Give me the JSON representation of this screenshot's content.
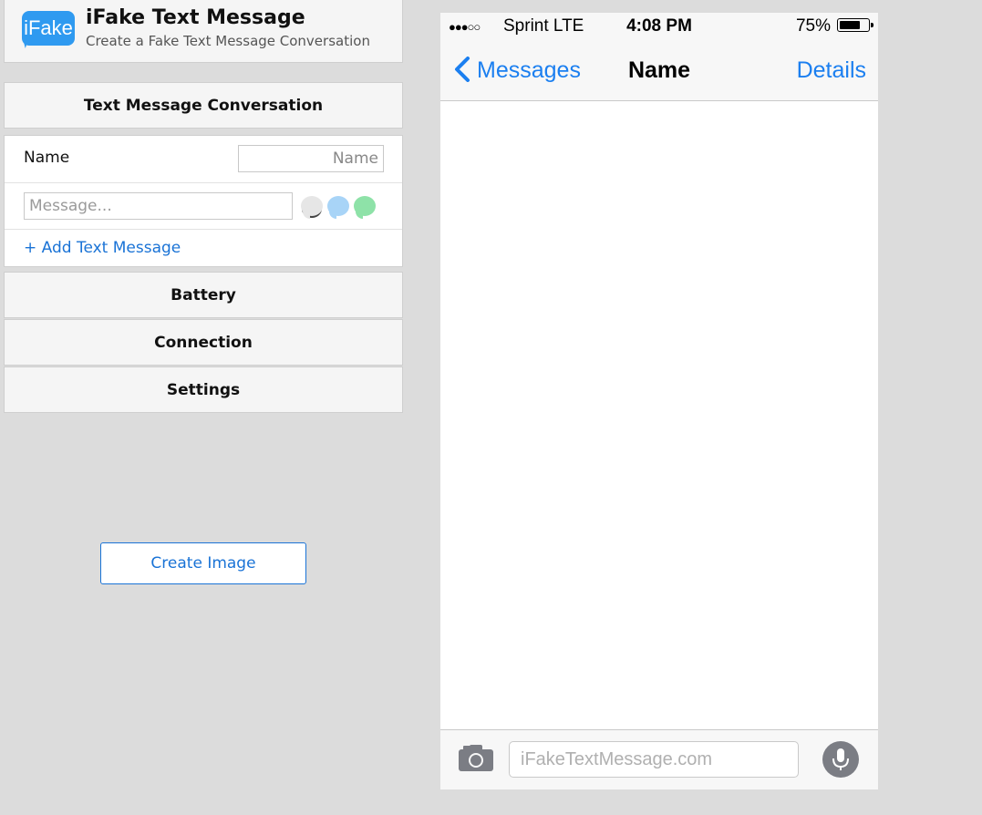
{
  "app": {
    "logo_text": "iFake",
    "title": "iFake Text Message",
    "subtitle": "Create a Fake Text Message Conversation"
  },
  "conversation": {
    "heading": "Text Message Conversation",
    "name_label": "Name",
    "name_placeholder": "Name",
    "message_placeholder": "Message...",
    "add_label": "+ Add Text Message"
  },
  "sections": {
    "battery": "Battery",
    "connection": "Connection",
    "settings": "Settings"
  },
  "actions": {
    "create_image": "Create Image"
  },
  "phone": {
    "signal": "●●●○○",
    "carrier": "Sprint  LTE",
    "time": "4:08 PM",
    "battery_percent": "75%",
    "battery_level": 0.75,
    "back_label": "Messages",
    "contact_name": "Name",
    "details_label": "Details",
    "compose_placeholder": "iFakeTextMessage.com"
  },
  "colors": {
    "link_blue": "#1a73d6",
    "ios_blue": "#1b7ff0",
    "bubble_gray": "#e6e6e6",
    "bubble_blue": "#a8d4f7",
    "bubble_green": "#8ee2a8"
  }
}
